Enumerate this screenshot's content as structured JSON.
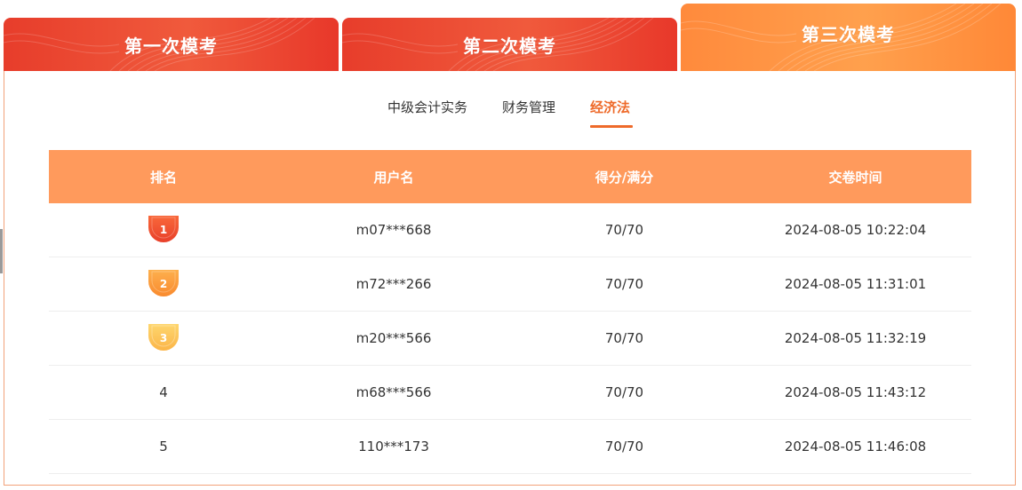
{
  "tabs": [
    {
      "label": "第一次模考"
    },
    {
      "label": "第二次模考"
    },
    {
      "label": "第三次模考"
    }
  ],
  "subtabs": [
    {
      "label": "中级会计实务"
    },
    {
      "label": "财务管理"
    },
    {
      "label": "经济法"
    }
  ],
  "table": {
    "headers": [
      "排名",
      "用户名",
      "得分/满分",
      "交卷时间"
    ],
    "rows": [
      {
        "rank": "1",
        "user": "m07***668",
        "score": "70/70",
        "time": "2024-08-05 10:22:04"
      },
      {
        "rank": "2",
        "user": "m72***266",
        "score": "70/70",
        "time": "2024-08-05 11:31:01"
      },
      {
        "rank": "3",
        "user": "m20***566",
        "score": "70/70",
        "time": "2024-08-05 11:32:19"
      },
      {
        "rank": "4",
        "user": "m68***566",
        "score": "70/70",
        "time": "2024-08-05 11:43:12"
      },
      {
        "rank": "5",
        "user": "110***173",
        "score": "70/70",
        "time": "2024-08-05 11:46:08"
      }
    ]
  },
  "colors": {
    "tab_red": "#e73d2b",
    "tab_active": "#ff9a45",
    "header_bg": "#ff9a5c",
    "accent": "#ee6a2a",
    "medal_gold": "#f04a2c",
    "medal_silver": "#fb9a3a",
    "medal_bronze": "#fcc15a"
  },
  "icons": {
    "medal_1": "medal-icon",
    "medal_2": "medal-icon",
    "medal_3": "medal-icon"
  }
}
